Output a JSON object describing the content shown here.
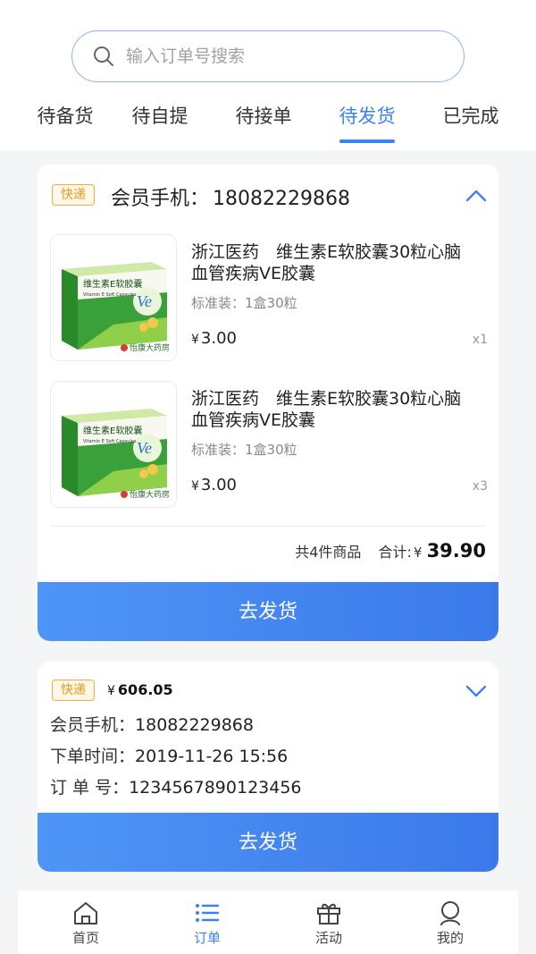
{
  "search": {
    "placeholder": "输入订单号搜索"
  },
  "tabs": [
    {
      "label": "待备货"
    },
    {
      "label": "待自提"
    },
    {
      "label": "待接单"
    },
    {
      "label": "待发货"
    },
    {
      "label": "已完成"
    }
  ],
  "active_tab": 3,
  "order1": {
    "badge": "快递",
    "phone_label": "会员手机：",
    "phone": "18082229868",
    "items": [
      {
        "name": "浙江医药　维生素E软胶囊30粒心脑血管疾病VE胶囊",
        "spec": "标准装：1盒30粒",
        "currency": "¥",
        "price": "3.00",
        "qty": "x1",
        "pack_title": "维生素E软胶囊",
        "pack_sub": "Vitamin E Soft Capsules",
        "pack_brand": "怡康大药房"
      },
      {
        "name": "浙江医药　维生素E软胶囊30粒心脑血管疾病VE胶囊",
        "spec": "标准装：1盒30粒",
        "currency": "¥",
        "price": "3.00",
        "qty": "x3",
        "pack_title": "维生素E软胶囊",
        "pack_sub": "Vitamin E Soft Capsules",
        "pack_brand": "怡康大药房"
      }
    ],
    "count_text": "共4件商品",
    "total_label": "合计:",
    "currency": "¥",
    "total": "39.90",
    "button": "去发货"
  },
  "order2": {
    "badge": "快递",
    "currency": "¥",
    "price": "606.05",
    "phone_label": "会员手机：",
    "phone": "18082229868",
    "time_label": "下单时间：",
    "time": "2019-11-26 15:56",
    "order_label": "订 单 号：",
    "order_no": "1234567890123456",
    "button": "去发货"
  },
  "nav": [
    {
      "label": "首页",
      "icon": "home-icon"
    },
    {
      "label": "订单",
      "icon": "list-icon"
    },
    {
      "label": "活动",
      "icon": "gift-icon"
    },
    {
      "label": "我的",
      "icon": "user-icon"
    }
  ],
  "colors": {
    "accent": "#3b82f0",
    "badge": "#ec9a16",
    "bg": "#f4f5f7"
  }
}
